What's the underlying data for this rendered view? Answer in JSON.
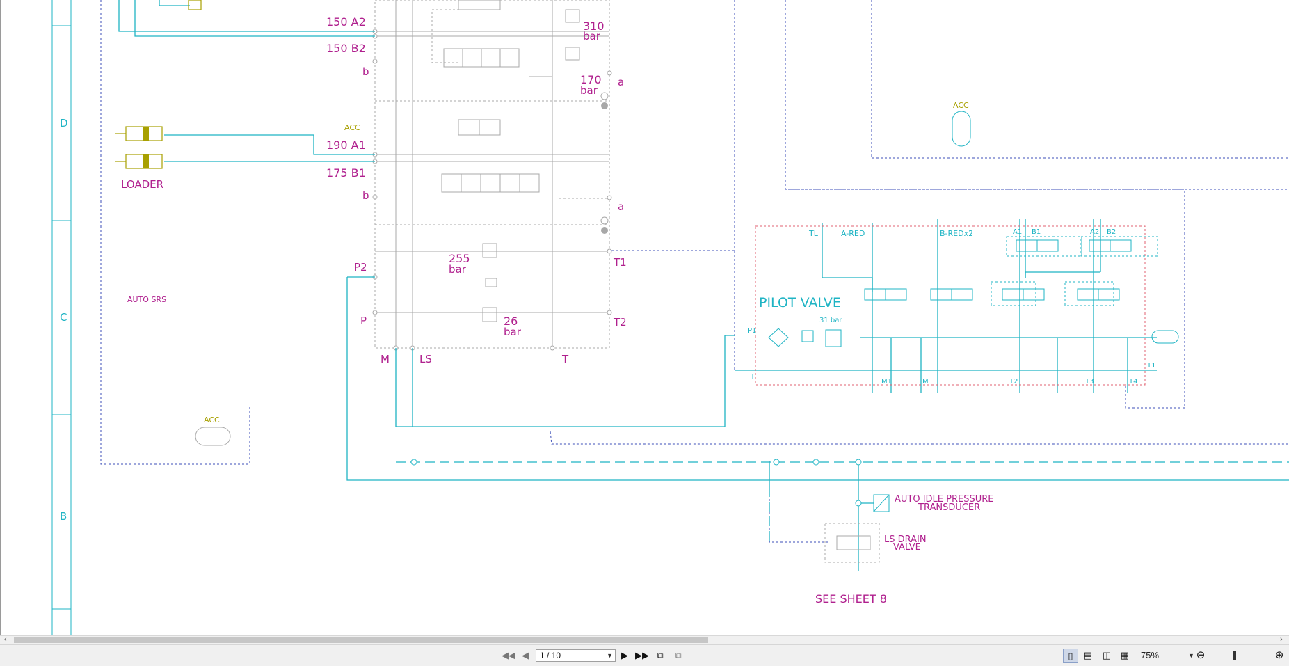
{
  "drawing": {
    "zone_labels": [
      "D",
      "C",
      "B"
    ],
    "labels_magenta": {
      "a2": "150  A2",
      "b2": "150  B2",
      "p310_val": "310",
      "bar": "bar",
      "p170_val": "170",
      "port_a": "a",
      "port_b": "b",
      "a1": "190  A1",
      "b1": "175  B1",
      "loader": "LOADER",
      "auto_srs": "AUTO SRS",
      "p2": "P2",
      "p": "P",
      "p255_val": "255",
      "p26_val": "26",
      "t1": "T1",
      "t2": "T2",
      "m": "M",
      "ls": "LS",
      "t": "T",
      "auto_idle_line1": "AUTO IDLE PRESSURE",
      "auto_idle_line2": "TRANSDUCER",
      "ls_drain_line1": "LS DRAIN",
      "ls_drain_line2": "VALVE",
      "see_sheet": "SEE SHEET 8"
    },
    "labels_olive": {
      "acc": "ACC"
    },
    "labels_cyan": {
      "pilot_valve": "PILOT VALVE",
      "tl": "TL",
      "a_red": "A-RED",
      "b_red": "B-REDx2",
      "a1": "A1",
      "b1": "B1",
      "a2": "A2",
      "b2": "B2",
      "p1": "P1",
      "p31": "31 bar",
      "t": "T",
      "m1": "M1",
      "m": "M",
      "t2": "T2",
      "t3": "T3",
      "t4": "T4",
      "t1": "T1"
    }
  },
  "statusbar": {
    "page_indicator": "1 / 10",
    "zoom": "75%"
  }
}
